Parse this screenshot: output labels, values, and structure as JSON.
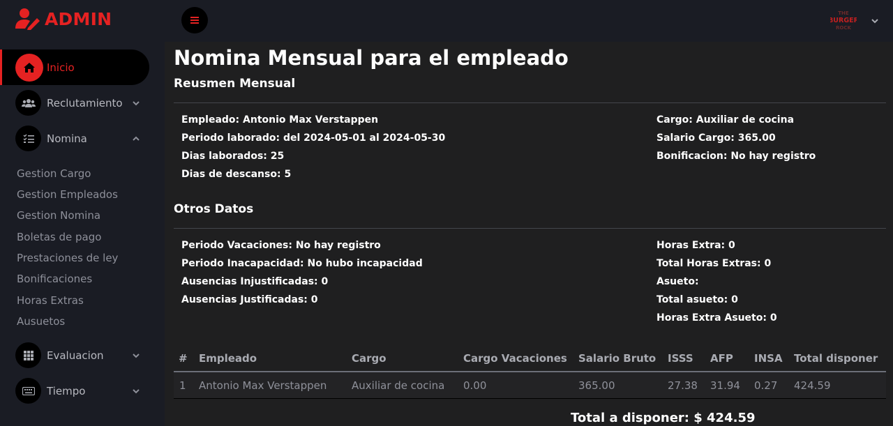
{
  "brand": {
    "name": "ADMIN",
    "accent": "#e52222"
  },
  "sidebar": {
    "items": [
      {
        "label": "Inicio",
        "icon": "home-icon",
        "active": true
      },
      {
        "label": "Reclutamiento",
        "icon": "users-icon"
      },
      {
        "label": "Nomina",
        "icon": "tasks-icon",
        "expanded": true
      },
      {
        "label": "Evaluacion",
        "icon": "grid-icon"
      },
      {
        "label": "Tiempo",
        "icon": "keyboard-icon"
      }
    ],
    "nomina_subitems": [
      "Gestion Cargo",
      "Gestion Empleados",
      "Gestion Nomina",
      "Boletas de pago",
      "Prestaciones de ley",
      "Bonificaciones",
      "Horas Extras",
      "Ausuetos"
    ]
  },
  "topbar": {
    "logo_line1": "THE",
    "logo_line2": "BURGER",
    "logo_line3": "ROCK"
  },
  "main": {
    "title": "Nomina Mensual para el empleado",
    "summary": {
      "title": "Reusmen Mensual",
      "left": [
        "Empleado: Antonio Max Verstappen",
        "Periodo laborado: del 2024-05-01 al 2024-05-30",
        "Dias laborados: 25",
        "Dias de descanso: 5"
      ],
      "right": [
        "Cargo: Auxiliar de cocina",
        "Salario Cargo: 365.00",
        "Bonificacion: No hay registro"
      ]
    },
    "other": {
      "title": "Otros Datos",
      "left": [
        "Periodo Vacaciones: No hay registro",
        "Periodo Inacapacidad: No hubo incapacidad",
        "Ausencias Injustificadas: 0",
        "Ausencias Justificadas: 0"
      ],
      "right": [
        "Horas Extra: 0",
        "Total Horas Extras: 0",
        "Asueto:",
        "Total asueto: 0",
        "Horas Extra Asueto: 0"
      ]
    },
    "table": {
      "headers": [
        "#",
        "Empleado",
        "Cargo",
        "Cargo Vacaciones",
        "Salario Bruto",
        "ISSS",
        "AFP",
        "INSA",
        "Total disponer"
      ],
      "rows": [
        [
          "1",
          "Antonio Max Verstappen",
          "Auxiliar de cocina",
          "0.00",
          "365.00",
          "27.38",
          "31.94",
          "0.27",
          "424.59"
        ]
      ]
    },
    "total": "Total a disponer: $ 424.59"
  }
}
